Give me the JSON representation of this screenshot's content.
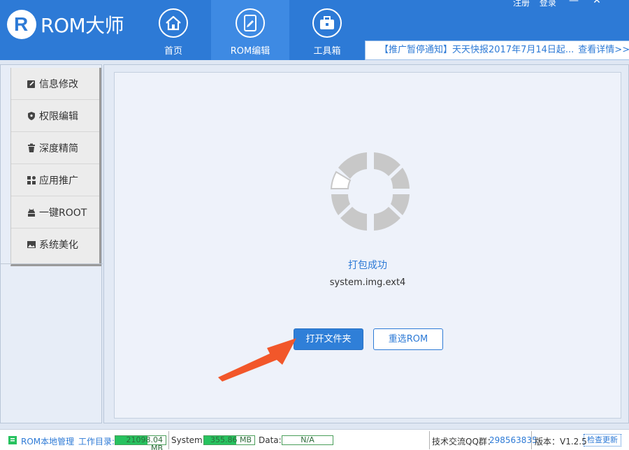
{
  "app": {
    "name": "ROM大师",
    "logo_letter": "R"
  },
  "top_links": {
    "register": "注册",
    "login": "登录"
  },
  "window_controls": {
    "minimize": "—",
    "close": "✕"
  },
  "nav": {
    "tabs": [
      {
        "label": "首页",
        "icon": "home-icon"
      },
      {
        "label": "ROM编辑",
        "icon": "rom-edit-icon",
        "active": true
      },
      {
        "label": "工具箱",
        "icon": "toolbox-icon"
      }
    ]
  },
  "notice": {
    "text": "【推广暂停通知】天天快报2017年7月14日起...",
    "more": "查看详情>>"
  },
  "sidebar": {
    "items": [
      {
        "label": "信息修改",
        "icon": "edit-icon"
      },
      {
        "label": "权限编辑",
        "icon": "shield-icon"
      },
      {
        "label": "深度精简",
        "icon": "trash-icon"
      },
      {
        "label": "应用推广",
        "icon": "apps-icon"
      },
      {
        "label": "一键ROOT",
        "icon": "android-icon"
      },
      {
        "label": "系统美化",
        "icon": "image-icon"
      }
    ]
  },
  "main": {
    "status": "打包成功",
    "file": "system.img.ext4",
    "open_folder_button": "打开文件夹",
    "reselect_button": "重选ROM"
  },
  "statusbar": {
    "local_manage": "ROM本地管理",
    "workdir_label": "工作目录:",
    "workdir_value": "21098.04 MB",
    "system_label": "System:",
    "system_value": "355.86 MB",
    "data_label": "Data:",
    "data_value": "N/A",
    "qq_label": "技术交流QQ群：",
    "qq_value": "298563835",
    "version_label": "版本：V1.2.5",
    "check_update": "检查更新"
  },
  "colors": {
    "brand": "#2d7ad6",
    "meter": "#27c25f",
    "arrow": "#f2572a"
  }
}
